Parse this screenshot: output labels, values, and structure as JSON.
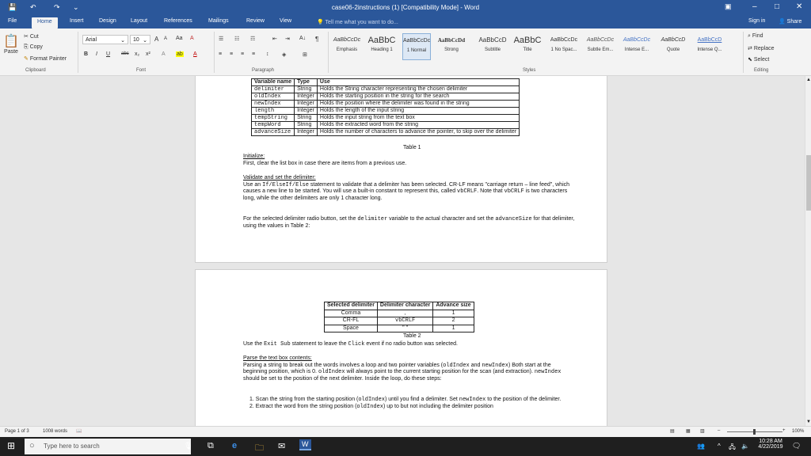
{
  "window": {
    "title": "case06-2instructions (1) [Compatibility Mode] - Word",
    "save_icon": "💾",
    "undo_icon": "↶",
    "redo_icon": "↷",
    "qa_more": "⌄",
    "ribbon_display": "▣",
    "minimize": "–",
    "maximize": "□",
    "close": "✕"
  },
  "tabs": [
    "File",
    "Home",
    "Insert",
    "Design",
    "Layout",
    "References",
    "Mailings",
    "Review",
    "View"
  ],
  "tell_me": "Tell me what you want to do...",
  "sign_in": "Sign in",
  "share": "Share",
  "clipboard": {
    "paste": "Paste",
    "cut": "Cut",
    "copy": "Copy",
    "format_painter": "Format Painter",
    "group": "Clipboard"
  },
  "font": {
    "name": "Arial",
    "size": "10",
    "bold": "B",
    "italic": "I",
    "underline": "U",
    "strike": "abc",
    "sub": "x₂",
    "sup": "x²",
    "grow": "A",
    "shrink": "A",
    "case": "Aa",
    "clear": "A",
    "highlight": "ab",
    "color": "A",
    "effects": "A",
    "group": "Font"
  },
  "paragraph": {
    "group": "Paragraph",
    "sort": "A↓",
    "pilcrow": "¶"
  },
  "styles": {
    "group": "Styles",
    "items": [
      {
        "sample": "AaBbCcDc",
        "name": "Emphasis"
      },
      {
        "sample": "AaBbC",
        "name": "Heading 1"
      },
      {
        "sample": "AaBbCcDc",
        "name": "1 Normal"
      },
      {
        "sample": "AaBbCcDd",
        "name": "Strong"
      },
      {
        "sample": "AaBbCcD",
        "name": "Subtitle"
      },
      {
        "sample": "AaBbC",
        "name": "Title"
      },
      {
        "sample": "AaBbCcDc",
        "name": "1 No Spac..."
      },
      {
        "sample": "AaBbCcDc",
        "name": "Subtle Em..."
      },
      {
        "sample": "AaBbCcDc",
        "name": "Intense E..."
      },
      {
        "sample": "AaBbCcD",
        "name": "Quote"
      },
      {
        "sample": "AaBbCcD",
        "name": "Intense Q..."
      }
    ]
  },
  "editing": {
    "find": "Find",
    "replace": "Replace",
    "select": "Select",
    "group": "Editing"
  },
  "table1": {
    "headers": [
      "Variable name",
      "Type",
      "Use"
    ],
    "rows": [
      [
        "delimiter",
        "String",
        "Holds the String character representing the chosen delimiter"
      ],
      [
        "oldIndex",
        "Integer",
        "Holds the starting position in the string for the search"
      ],
      [
        "newIndex",
        "Integer",
        "Holds the position where the delimiter was found in the string"
      ],
      [
        "length",
        "Integer",
        "Holds the length of the input string"
      ],
      [
        "tempString",
        "String",
        "Holds the input string from the text box"
      ],
      [
        "tempWord",
        "String",
        "Holds the extracted word from the string"
      ],
      [
        "advanceSize",
        "Integer",
        "Holds the number of characters to advance the pointer, to skip over the delimiter"
      ]
    ],
    "caption": "Table 1"
  },
  "p1": {
    "heading": "Initialize:",
    "text": "First, clear the list box in case there are items from a previous use."
  },
  "p2": {
    "heading": "Validate and set the delimiter:",
    "a": "Use an ",
    "code1": "If/ElseIf/Else",
    "b": " statement to validate that a delimiter has been selected. CR-LF means \"carriage return – line feed\", which causes a new line to be started. You will use a built-in constant to represent this, called ",
    "code2": "vbCRLF",
    "c": ". Note that ",
    "code3": "vbCRLF",
    "d": " is two characters long, while the other delimiters are only 1 character long."
  },
  "p3": {
    "a": "For the selected delimiter radio button, set the ",
    "code1": "delimiter",
    "b": " variable to the actual character and set the ",
    "code2": "advanceSize",
    "c": " for that delimiter, using the values in Table 2:"
  },
  "table2": {
    "headers": [
      "Selected delimiter",
      "Delimiter character",
      "Advance size"
    ],
    "rows": [
      [
        "Comma",
        ",",
        "1"
      ],
      [
        "CR-FL",
        "vbCRLF",
        "2"
      ],
      [
        "Space",
        "\" \"",
        "1"
      ]
    ],
    "caption": "Table 2"
  },
  "p4": {
    "a": "Use the ",
    "code1": "Exit Sub",
    "b": " statement to leave the ",
    "code2": "Click",
    "c": " event if no radio button was selected."
  },
  "p5": {
    "heading": "Parse the text box contents:",
    "a": "Parsing a string to break out the words involves a loop and two pointer variables (",
    "code1": "oldIndex",
    "b": " and ",
    "code2": "newIndex",
    "c": ") Both start at the beginning position, which is 0. ",
    "code3": "oldIndex",
    "d": " will always point to the current starting position for the scan (and extraction). ",
    "code4": "newIndex",
    "e": " should be set to the position of the next delimiter. Inside the loop, do these steps:"
  },
  "steps": [
    {
      "num": "1.",
      "a": "Scan the string from the starting position (",
      "code": "oldIndex",
      "b": ") until you find a delimiter. Set ",
      "code2": "newIndex",
      "c": " to the position of the delimiter."
    },
    {
      "num": "2.",
      "a": "Extract the word from the string position (",
      "code": "oldIndex",
      "b": ") up to but not including the delimiter position"
    }
  ],
  "status": {
    "page": "Page 1 of 3",
    "words": "1008 words",
    "zoom": "100%"
  },
  "taskbar": {
    "search_placeholder": "Type here to search",
    "time": "10:28 AM",
    "date": "4/22/2019"
  }
}
